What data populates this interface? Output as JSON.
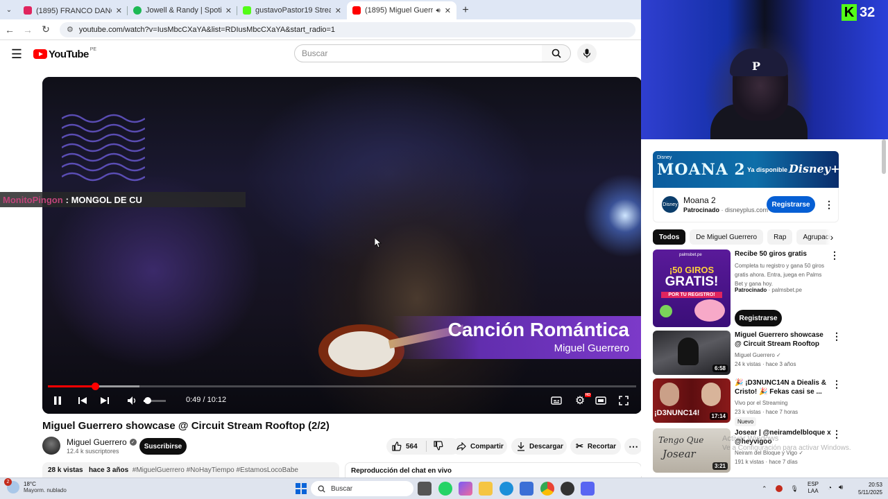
{
  "browser": {
    "tabs": [
      {
        "title": "(1895) FRANCO DANÓS 🕊️ - F",
        "favicon_color": "#e0245e"
      },
      {
        "title": "Jowell & Randy | Spotify",
        "favicon_color": "#1db954"
      },
      {
        "title": "gustavoPastor19 Stream - Wat",
        "favicon_color": "#53fc18"
      },
      {
        "title": "(1895) Miguel Guerrero sho",
        "favicon_color": "#ff0000"
      }
    ],
    "url": "youtube.com/watch?v=IusMbcCXaYA&list=RDIusMbcCXaYA&start_radio=1"
  },
  "youtube": {
    "logo_text": "YouTube",
    "country_code": "PE",
    "search_placeholder": "Buscar"
  },
  "video": {
    "title_card_line1": "Canción Romántica",
    "title_card_line2": "Miguel Guerrero",
    "current_time": "0:49",
    "total_time": "10:12",
    "time_display": "0:49 / 10:12",
    "progress": 0.08,
    "volume": 0.2,
    "settings_badge": "HD",
    "title": "Miguel Guerrero showcase @ Circuit Stream Rooftop (2/2)"
  },
  "chat_overlay": {
    "user": "MonitoPingon",
    "message": ": MONGOL DE CU"
  },
  "channel": {
    "name": "Miguel Guerrero",
    "subscribers": "12.4 k suscriptores",
    "subscribe_label": "Suscribirse"
  },
  "actions": {
    "likes": "564",
    "share": "Compartir",
    "download": "Descargar",
    "clip": "Recortar"
  },
  "description": {
    "views": "28 k vistas",
    "ago": "hace 3 años",
    "tags": "#MiguelGuerrero #NoHayTiempo #EstamosLocoBabe"
  },
  "chat_replay": "Reproducción del chat en vivo",
  "overlay": {
    "kick_letter": "K",
    "kick_number": "32"
  },
  "sidebar": {
    "ad": {
      "banner_disney": "Disney",
      "banner_title": "MOANA 2",
      "banner_available": "Ya disponible",
      "banner_brand": "Disney+",
      "logo_text": "Disney",
      "title": "Moana 2",
      "sponsored": "Patrocinado",
      "domain": "disneyplus.com",
      "button": "Registrarse"
    },
    "chips": [
      "Todos",
      "De Miguel Guerrero",
      "Rap",
      "Agrupaci"
    ],
    "recs": [
      {
        "title": "Recibe 50 giros gratis",
        "meta1": "Completa tu registro y gana 50 giros gratis ahora. Entra, juega en Palms Bet y gana hoy.",
        "sponsored": "Patrocinado",
        "domain": "palmsbet.pe",
        "button": "Registrarse",
        "thumb_brand": "palmsbet.pe",
        "thumb_line1": "¡50 GIROS",
        "thumb_line2": "GRATIS!",
        "thumb_line3": "POR TU REGISTRO!"
      },
      {
        "title": "Miguel Guerrero showcase @ Circuit Stream Rooftop",
        "channel": "Miguel Guerrero",
        "stats": "24 k vistas · hace 3 años",
        "duration": "6:58"
      },
      {
        "title": "🎉 ¡D3NUNC14N a Diealis & Cristo! 🎉 Fekas casi se ...",
        "channel": "Vivo por el Streaming",
        "stats": "23 k vistas · hace 7 horas",
        "badge": "Nuevo",
        "duration": "17:14",
        "thumb_text": "¡D3NUNC14!"
      },
      {
        "title": "Josear | @neiramdelbloque x @heyvigoo",
        "channel": "Neiram del Bloque y Vigo",
        "stats": "191 k vistas · hace 7 días",
        "duration": "3:21",
        "thumb_text1": "Tengo Que",
        "thumb_text2": "Josear"
      }
    ]
  },
  "watermark": {
    "line1": "Activar Windows",
    "line2": "Ve a Configuración para activar Windows."
  },
  "taskbar": {
    "notification_count": "2",
    "temperature": "18°C",
    "weather": "Mayorm. nublado",
    "search": "Buscar",
    "lang1": "ESP",
    "lang2": "LAA",
    "time": "20:53",
    "date": "5/11/2025"
  }
}
